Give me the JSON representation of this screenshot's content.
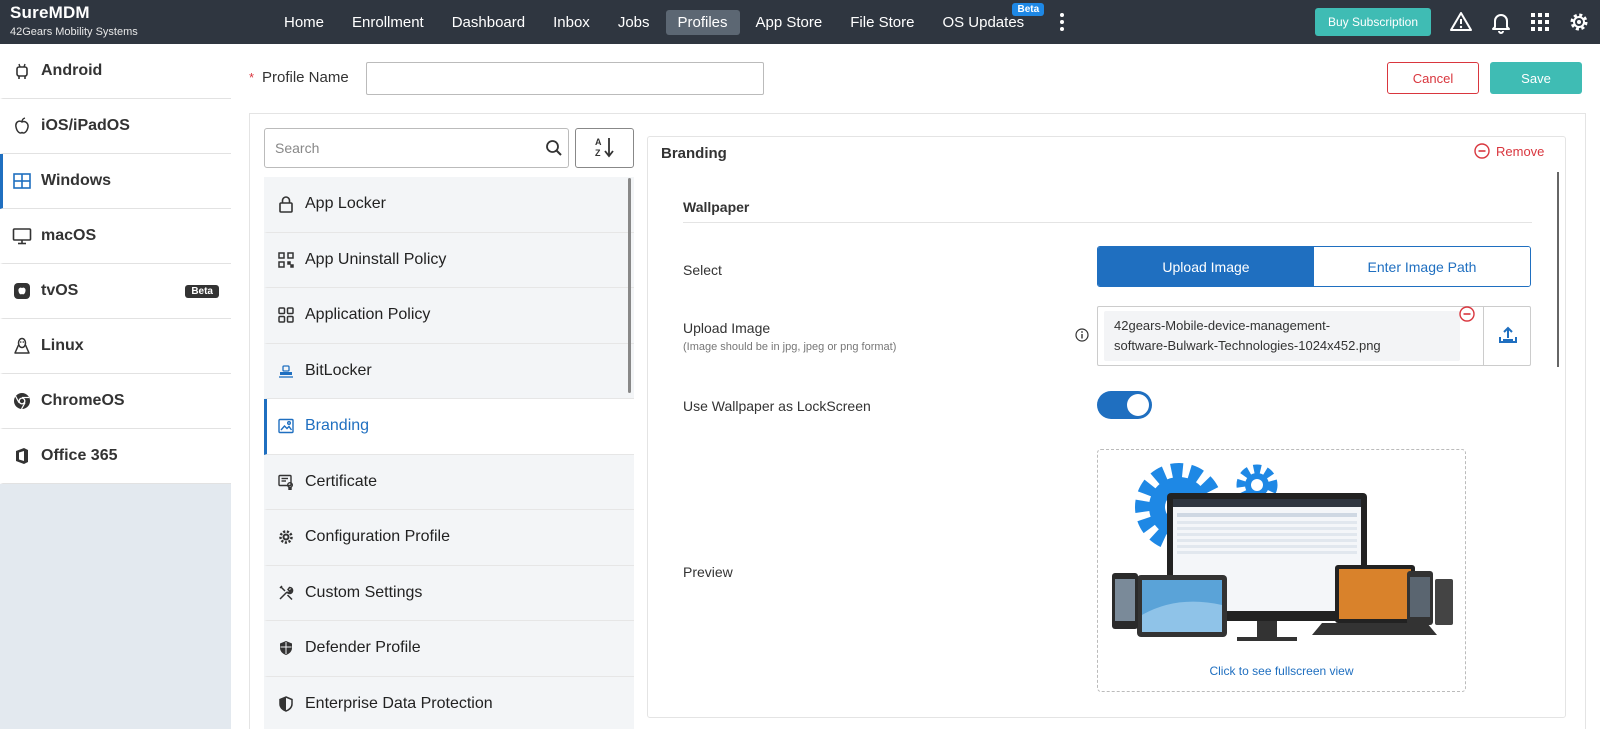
{
  "brand": {
    "title": "SureMDM",
    "subtitle": "42Gears Mobility Systems"
  },
  "nav": [
    {
      "label": "Home",
      "active": false
    },
    {
      "label": "Enrollment",
      "active": false
    },
    {
      "label": "Dashboard",
      "active": false
    },
    {
      "label": "Inbox",
      "active": false
    },
    {
      "label": "Jobs",
      "active": false
    },
    {
      "label": "Profiles",
      "active": true
    },
    {
      "label": "App Store",
      "active": false
    },
    {
      "label": "File Store",
      "active": false
    },
    {
      "label": "OS Updates",
      "active": false,
      "badge": "Beta"
    }
  ],
  "header_actions": {
    "buy_label": "Buy Subscription",
    "icons": [
      "warning-icon",
      "bell-icon",
      "apps-grid-icon",
      "gear-icon"
    ]
  },
  "os_platforms": [
    {
      "label": "Android",
      "icon": "android-icon",
      "active": false
    },
    {
      "label": "iOS/iPadOS",
      "icon": "apple-icon",
      "active": false
    },
    {
      "label": "Windows",
      "icon": "windows-icon",
      "active": true
    },
    {
      "label": "macOS",
      "icon": "monitor-icon",
      "active": false
    },
    {
      "label": "tvOS",
      "icon": "tvos-icon",
      "active": false,
      "badge": "Beta"
    },
    {
      "label": "Linux",
      "icon": "linux-icon",
      "active": false
    },
    {
      "label": "ChromeOS",
      "icon": "chrome-icon",
      "active": false
    },
    {
      "label": "Office 365",
      "icon": "office-icon",
      "active": false
    }
  ],
  "profile": {
    "required_mark": "*",
    "name_label": "Profile Name",
    "name_value": "",
    "cancel_label": "Cancel",
    "save_label": "Save"
  },
  "search": {
    "placeholder": "Search",
    "value": ""
  },
  "policies": [
    {
      "label": "App Locker",
      "icon": "lock-icon",
      "active": false
    },
    {
      "label": "App Uninstall Policy",
      "icon": "qr-icon",
      "active": false
    },
    {
      "label": "Application Policy",
      "icon": "apps-icon",
      "active": false
    },
    {
      "label": "BitLocker",
      "icon": "bitlocker-icon",
      "active": false
    },
    {
      "label": "Branding",
      "icon": "image-icon",
      "active": true
    },
    {
      "label": "Certificate",
      "icon": "certificate-icon",
      "active": false
    },
    {
      "label": "Configuration Profile",
      "icon": "cog-icon",
      "active": false
    },
    {
      "label": "Custom Settings",
      "icon": "tools-icon",
      "active": false
    },
    {
      "label": "Defender Profile",
      "icon": "shield-icon",
      "active": false
    },
    {
      "label": "Enterprise Data Protection",
      "icon": "shield-half-icon",
      "active": false
    }
  ],
  "config": {
    "title": "Branding",
    "remove_label": "Remove",
    "section_title": "Wallpaper",
    "select_label": "Select",
    "select_options": [
      {
        "label": "Upload Image",
        "active": true
      },
      {
        "label": "Enter Image Path",
        "active": false
      }
    ],
    "upload_label": "Upload Image",
    "upload_hint": "(Image should be in jpg, jpeg or png format)",
    "file_line1": "42gears-Mobile-device-management-",
    "file_line2": "software-Bulwark-Technologies-1024x452.png",
    "lockscreen_label": "Use Wallpaper as LockScreen",
    "lockscreen_on": true,
    "preview_label": "Preview",
    "preview_caption": "Click to see fullscreen view"
  },
  "colors": {
    "accent": "#1f6fc0",
    "teal": "#3fbcb4",
    "danger": "#d9363e",
    "topbar": "#2f3640"
  }
}
